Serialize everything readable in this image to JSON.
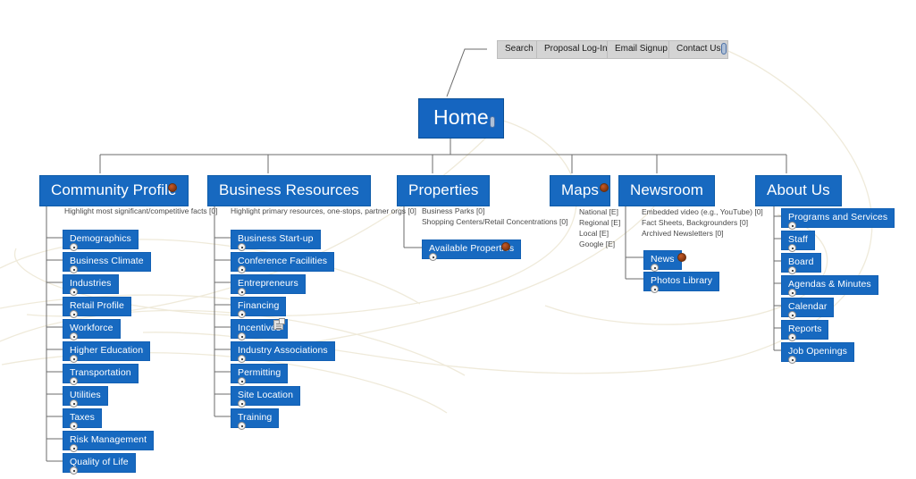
{
  "diagram": {
    "type": "sitemap",
    "root": {
      "label": "Home",
      "icon": "paperclip-icon"
    },
    "utility_bar": {
      "items": [
        {
          "label": "Search"
        },
        {
          "label": "Proposal Log-In"
        },
        {
          "label": "Email Signup"
        },
        {
          "label": "Contact Us"
        }
      ],
      "icon": "paperclip-icon"
    },
    "sections": [
      {
        "id": "community-profile",
        "label": "Community Profile",
        "icon": "seal-icon",
        "notes": [
          "Highlight most significant/competitive facts [0]"
        ],
        "children": [
          {
            "label": "Demographics"
          },
          {
            "label": "Business Climate"
          },
          {
            "label": "Industries"
          },
          {
            "label": "Retail Profile"
          },
          {
            "label": "Workforce"
          },
          {
            "label": "Higher Education"
          },
          {
            "label": "Transportation"
          },
          {
            "label": "Utilities"
          },
          {
            "label": "Taxes"
          },
          {
            "label": "Risk Management"
          },
          {
            "label": "Quality of Life"
          }
        ]
      },
      {
        "id": "business-resources",
        "label": "Business Resources",
        "icon": null,
        "notes": [
          "Highlight primary resources, one-stops, partner orgs [0]"
        ],
        "children": [
          {
            "label": "Business Start-up"
          },
          {
            "label": "Conference Facilities"
          },
          {
            "label": "Entrepreneurs"
          },
          {
            "label": "Financing"
          },
          {
            "label": "Incentives",
            "icon": "note-icon"
          },
          {
            "label": "Industry Associations"
          },
          {
            "label": "Permitting"
          },
          {
            "label": "Site Location"
          },
          {
            "label": "Training"
          }
        ]
      },
      {
        "id": "properties",
        "label": "Properties",
        "icon": null,
        "notes": [
          "Business Parks [0]",
          "Shopping Centers/Retail Concentrations [0]"
        ],
        "children": [
          {
            "label": "Available Properties",
            "icon": "seal-icon"
          }
        ]
      },
      {
        "id": "maps",
        "label": "Maps",
        "icon": "seal-icon",
        "notes": [
          "National [E]",
          "Regional [E]",
          "Local [E]",
          "Google [E]"
        ],
        "children": []
      },
      {
        "id": "newsroom",
        "label": "Newsroom",
        "icon": null,
        "notes": [
          "Embedded video (e.g., YouTube) [0]",
          "Fact Sheets, Backgrounders [0]",
          "Archived Newsletters [0]"
        ],
        "children": [
          {
            "label": "News",
            "icon": "seal-icon"
          },
          {
            "label": "Photos Library"
          }
        ]
      },
      {
        "id": "about-us",
        "label": "About Us",
        "icon": null,
        "notes": [],
        "children": [
          {
            "label": "Programs and Services"
          },
          {
            "label": "Staff"
          },
          {
            "label": "Board"
          },
          {
            "label": "Agendas & Minutes"
          },
          {
            "label": "Calendar"
          },
          {
            "label": "Reports"
          },
          {
            "label": "Job Openings"
          }
        ]
      }
    ],
    "colors": {
      "node_fill": "#1769c0",
      "node_text": "#ffffff",
      "utility_fill": "#d4d4d4",
      "connector": "#666666",
      "cross_link": "#f0ecd8",
      "note_text": "#4a4a4a",
      "background": "#ffffff"
    }
  }
}
